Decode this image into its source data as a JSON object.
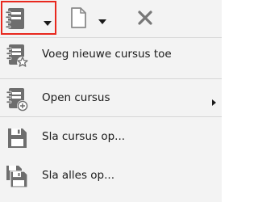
{
  "toolbar": {
    "buttons": [
      {
        "name": "course-notebook-button",
        "icon": "course-notebook-icon",
        "highlighted": true,
        "has_dropdown": true
      },
      {
        "name": "new-document-button",
        "icon": "blank-document-icon",
        "has_dropdown": true
      },
      {
        "name": "close-button",
        "icon": "close-icon"
      }
    ]
  },
  "menu": {
    "items": [
      {
        "label": "Voeg nieuwe cursus toe",
        "icon": "notebook-star-icon"
      },
      {
        "label": "Open cursus",
        "icon": "notebook-add-icon",
        "submenu": true
      },
      {
        "label": "Sla cursus op...",
        "icon": "floppy-disk-icon"
      },
      {
        "label": "Sla alles op...",
        "icon": "floppy-disks-icon"
      }
    ]
  },
  "colors": {
    "highlight_border": "#e8281e",
    "background": "#f3f3f3",
    "icon_gray": "#6e6e6e"
  }
}
